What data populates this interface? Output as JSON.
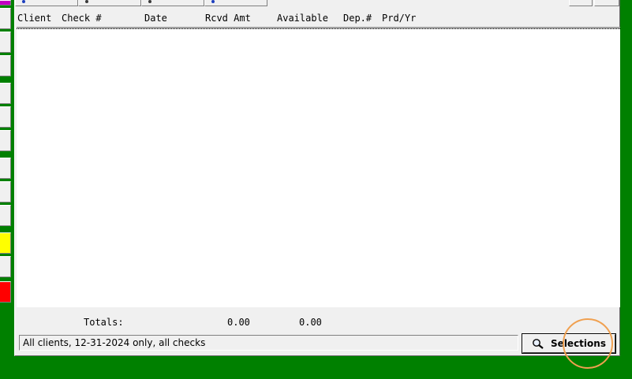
{
  "columns": {
    "client": "Client",
    "check": "Check #",
    "date": "Date",
    "rcvd_amt": "Rcvd Amt",
    "available": "Available",
    "dep": "Dep.#",
    "prd_yr": "Prd/Yr"
  },
  "totals": {
    "label": "Totals:",
    "rcvd_amt": "0.00",
    "available": "0.00"
  },
  "status": {
    "filter_text": "All clients, 12-31-2024 only, all checks"
  },
  "buttons": {
    "selections_label": "Selections"
  },
  "colors": {
    "background": "#008000",
    "panel": "#f0f0f0",
    "side_yellow": "#ffff00",
    "side_red": "#ff0000",
    "side_magenta": "#c000c0",
    "highlight": "#f0a050"
  }
}
